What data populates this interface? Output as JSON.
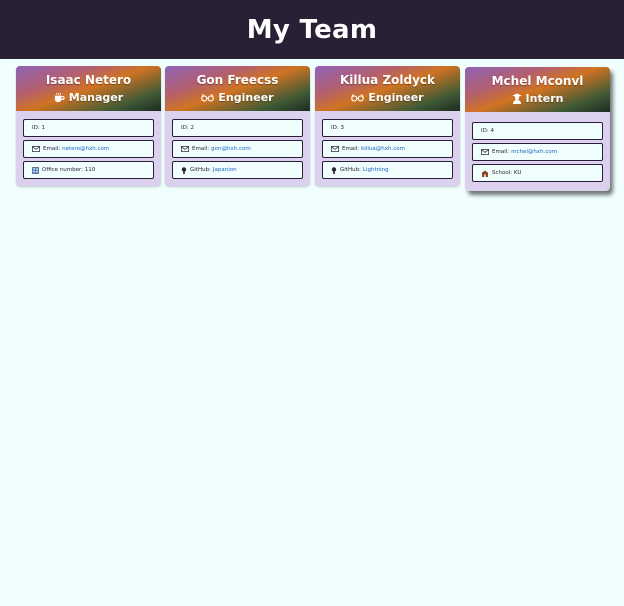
{
  "header": {
    "title": "My Team"
  },
  "members": [
    {
      "name": "Isaac Netero",
      "role": "Manager",
      "role_icon": "coffee-icon",
      "id_label": "ID: 1",
      "email_label": "Email:",
      "email": "netero@hxh.com",
      "extra_label": "Office number:",
      "extra_value": "110",
      "extra_icon": "building-icon"
    },
    {
      "name": "Gon Freecss",
      "role": "Engineer",
      "role_icon": "glasses-icon",
      "id_label": "ID: 2",
      "email_label": "Email:",
      "email": "gon@hxh.com",
      "extra_label": "GitHub:",
      "extra_value": "Japanion",
      "extra_icon": "github-icon"
    },
    {
      "name": "Killua Zoldyck",
      "role": "Engineer",
      "role_icon": "glasses-icon",
      "id_label": "ID: 3",
      "email_label": "Email:",
      "email": "killua@hxh.com",
      "extra_label": "GitHub:",
      "extra_value": "Lightning",
      "extra_icon": "github-icon"
    },
    {
      "name": "Mchel Mconvl",
      "role": "Intern",
      "role_icon": "graduate-icon",
      "id_label": "ID: 4",
      "email_label": "Email:",
      "email": "mchel@hxh.com",
      "extra_label": "School:",
      "extra_value": "KU",
      "extra_icon": "school-icon"
    }
  ]
}
